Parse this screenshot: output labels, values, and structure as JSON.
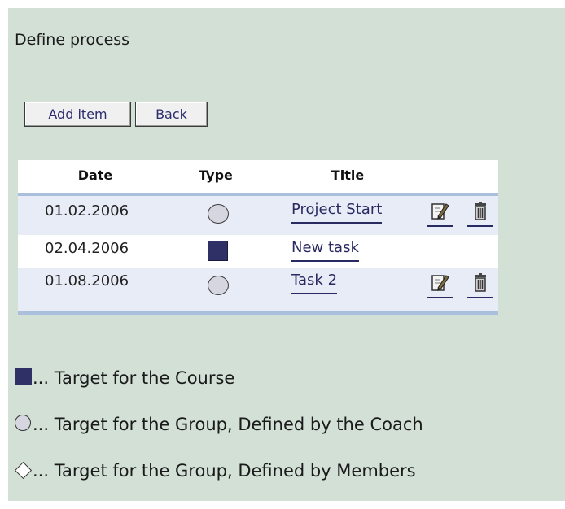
{
  "page": {
    "title": "Define process"
  },
  "toolbar": {
    "add_label": "Add item",
    "back_label": "Back"
  },
  "table": {
    "headers": {
      "date": "Date",
      "type": "Type",
      "title": "Title"
    },
    "rows": [
      {
        "date": "01.02.2006",
        "type": "circle",
        "title": "Project Start",
        "editable": true
      },
      {
        "date": "02.04.2006",
        "type": "square",
        "title": "New task",
        "editable": false
      },
      {
        "date": "01.08.2006",
        "type": "circle",
        "title": "Task 2",
        "editable": true
      }
    ]
  },
  "legend": {
    "square": "... Target for the Course",
    "circle": "... Target for the Group, Defined by the Coach",
    "diamond": "... Target for the Group, Defined by Members"
  },
  "icons": {
    "edit": "pencil-note-icon",
    "delete": "trash-can-icon"
  },
  "colors": {
    "background": "#d2e0d6",
    "course_target": "#2f3066",
    "group_target": "#d5d6df",
    "link": "#2a2a62",
    "rule": "#a9bfdc"
  }
}
